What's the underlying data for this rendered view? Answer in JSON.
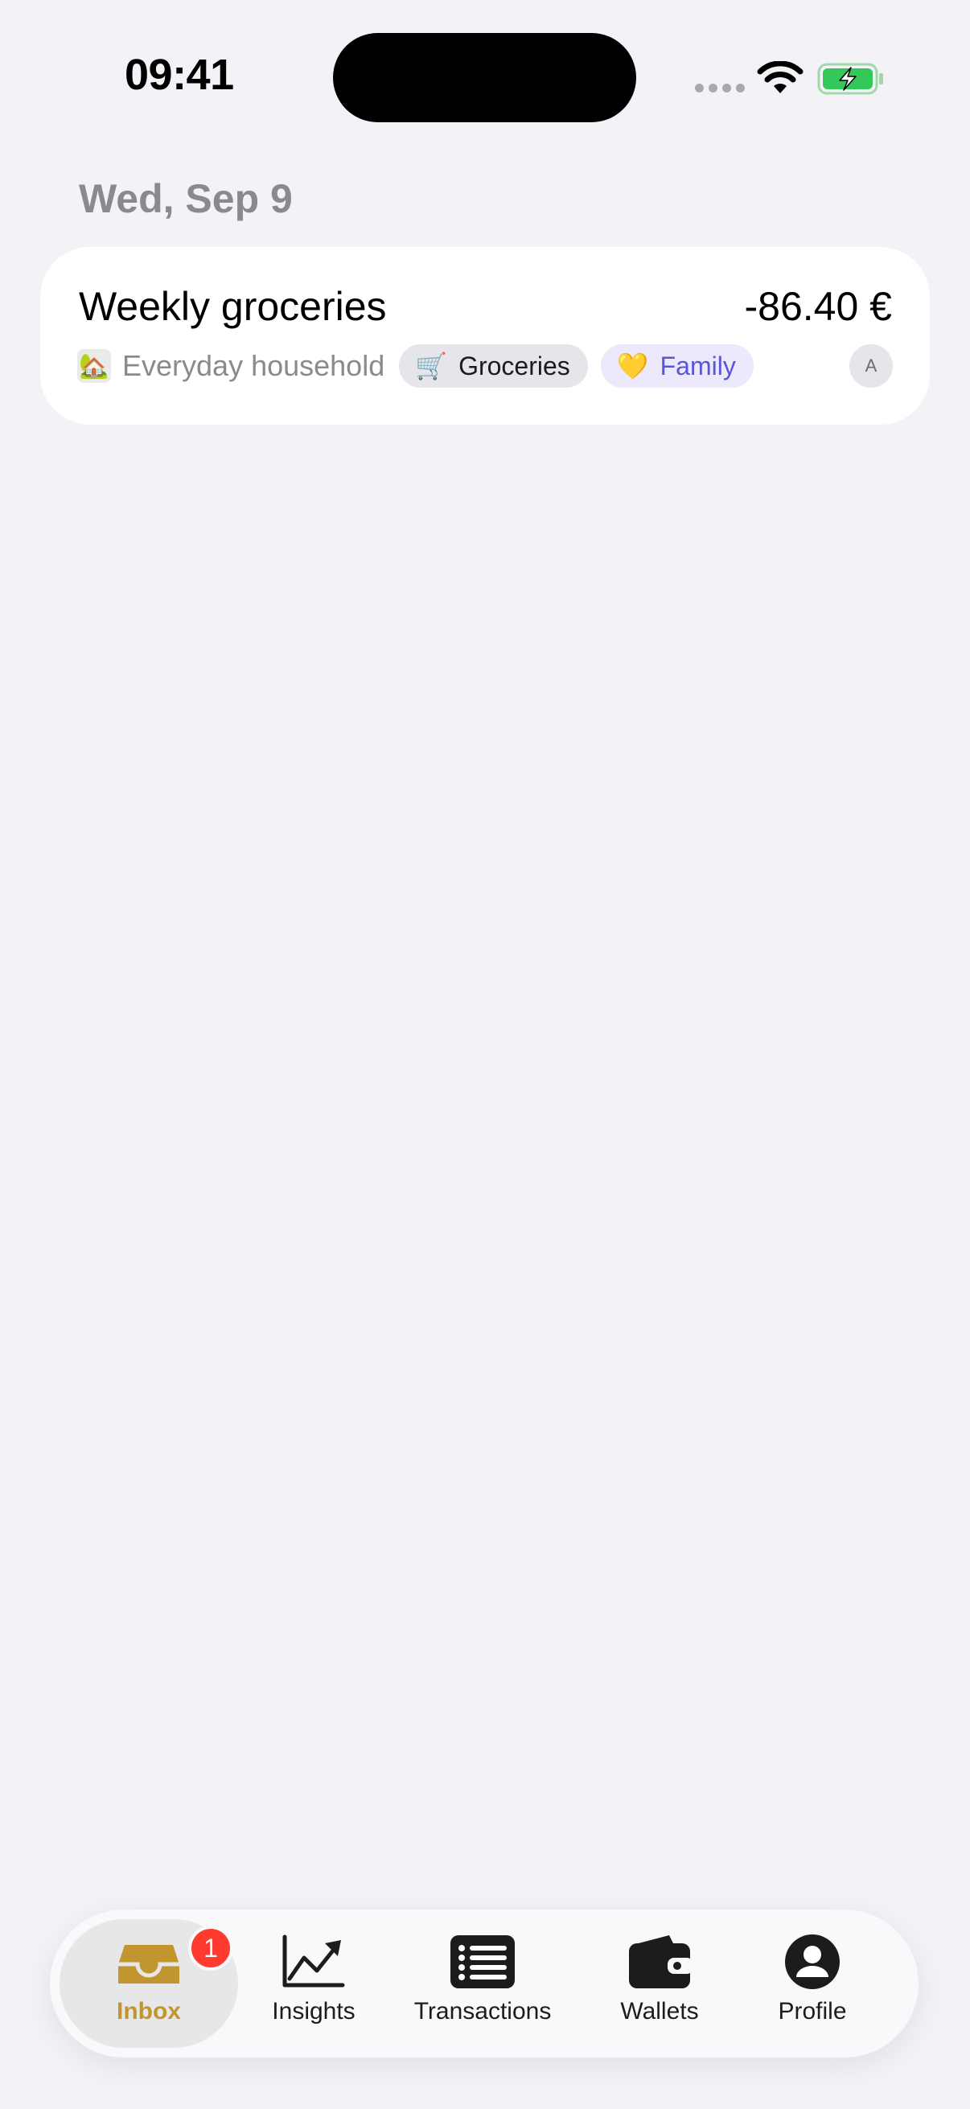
{
  "status_bar": {
    "time": "09:41"
  },
  "section": {
    "date": "Wed, Sep 9"
  },
  "transaction": {
    "title": "Weekly groceries",
    "amount": "-86.40 €",
    "wallet_emoji": "🏡",
    "wallet": "Everyday household",
    "category_emoji": "🛒",
    "category": "Groceries",
    "tag_emoji": "💛",
    "tag": "Family",
    "avatar_initial": "A"
  },
  "tabbar": {
    "inbox": {
      "label": "Inbox",
      "badge": "1",
      "icon": "inbox-icon"
    },
    "insights": {
      "label": "Insights",
      "icon": "chart-trend-icon"
    },
    "transactions": {
      "label": "Transactions",
      "icon": "list-icon"
    },
    "wallets": {
      "label": "Wallets",
      "icon": "wallet-icon"
    },
    "profile": {
      "label": "Profile",
      "icon": "person-icon"
    }
  },
  "colors": {
    "accent": "#c2962f",
    "badge": "#ff3b30",
    "tag_family": "#5856d6",
    "battery": "#34c759"
  }
}
